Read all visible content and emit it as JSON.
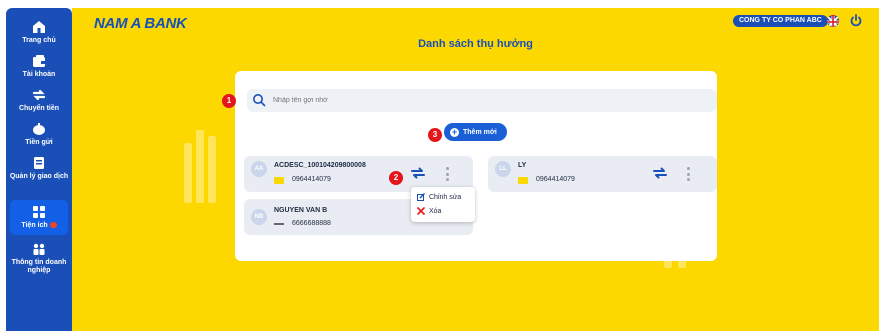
{
  "sidebar": {
    "items": [
      {
        "label": "Trang chủ",
        "icon": "home-icon"
      },
      {
        "label": "Tài khoản",
        "icon": "wallet-icon"
      },
      {
        "label": "Chuyển tiền",
        "icon": "transfer-icon"
      },
      {
        "label": "Tiền gửi",
        "icon": "piggy-bank-icon"
      },
      {
        "label": "Quản lý giao dịch",
        "icon": "document-icon"
      },
      {
        "label": "Tiện ích",
        "icon": "grid-icon",
        "active": true
      },
      {
        "label_line1": "Thông tin doanh",
        "label_line2": "nghiệp",
        "icon": "people-icon"
      }
    ]
  },
  "header": {
    "logo": "NAM A BANK",
    "company": "CONG TY CO PHAN ABC",
    "page_title": "Danh sách thụ hưởng"
  },
  "search": {
    "placeholder": "Nhập tên gợi nhớ"
  },
  "markers": [
    "1",
    "2",
    "3"
  ],
  "add_button": {
    "label": "Thêm mới"
  },
  "beneficiaries": [
    {
      "initials": "AA",
      "name": "ACDESC_100104209800008",
      "account": "0964414079"
    },
    {
      "initials": "LL",
      "name": "LY",
      "account": "0964414079"
    },
    {
      "initials": "NB",
      "name": "NGUYEN VAN B",
      "account": "6666688888"
    }
  ],
  "context_menu": {
    "edit": "Chỉnh sửa",
    "delete": "Xóa"
  },
  "colors": {
    "sidebar": "#1a4fb8",
    "background": "#fdd800",
    "accent": "#1a5fd6",
    "marker": "#e4161c"
  }
}
